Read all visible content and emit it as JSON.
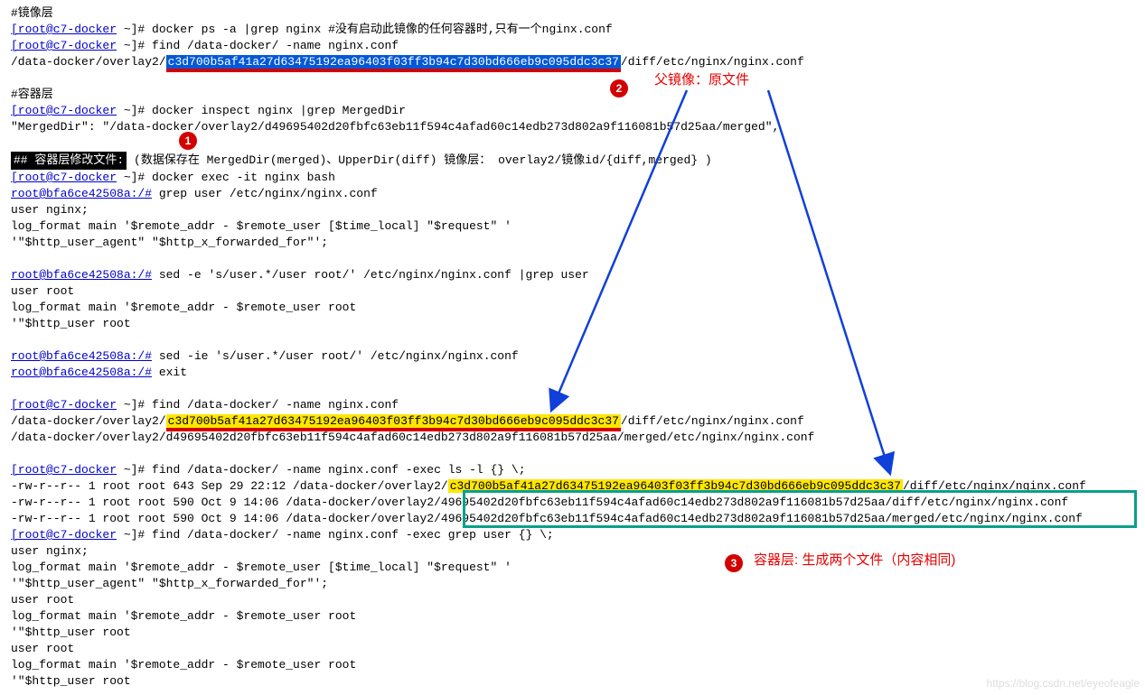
{
  "c1": "#镜像层",
  "c2": "#容器层",
  "host": "[root@c7-docker",
  "tilde": " ~]# ",
  "cont": "root@bfa6ce42508a:/#",
  "l1a": "docker ps -a |grep nginx   #没有启动此镜像的任何容器时,只有一个nginx.conf",
  "l2a": "find /data-docker/ -name nginx.conf",
  "l3_pref": "/data-docker/overlay2/",
  "hash1": "c3d700b5af41a27d63475192ea96403f03ff3b94c7d30bd666eb9c095ddc3c37",
  "l3_suf": "/diff/etc/nginx/nginx.conf",
  "l4a": "docker inspect nginx |grep MergedDir",
  "l5": "            \"MergedDir\": \"/data-docker/overlay2/d49695402d20fbfc63eb11f594c4afad60c14edb273d802a9f116081b57d25aa/merged\",",
  "l6_box": "##  容器层修改文件:",
  "l6_rest": " (数据保存在 MergedDir(merged)、UpperDir(diff) 镜像层：  overlay2/镜像id/{diff,merged} )",
  "l7a": "docker exec -it nginx bash",
  "l8a": " grep user /etc/nginx/nginx.conf",
  "l9": "user  nginx;",
  "l10": "    log_format  main  '$remote_addr - $remote_user [$time_local] \"$request\" '",
  "l11": "                      '\"$http_user_agent\" \"$http_x_forwarded_for\"';",
  "l12a": " sed -e 's/user.*/user root/' /etc/nginx/nginx.conf |grep user",
  "l13": "user root",
  "l14": "    log_format  main  '$remote_addr - $remote_user root",
  "l15": "                      '\"$http_user root",
  "l16a": " sed -ie 's/user.*/user root/' /etc/nginx/nginx.conf",
  "l17a": " exit",
  "l18a": "find /data-docker/ -name nginx.conf",
  "l19_path2": "/data-docker/overlay2/d49695402d20fbfc63eb11f594c4afad60c14edb273d802a9f116081b57d25aa/merged/etc/nginx/nginx.conf",
  "l20a": "find /data-docker/ -name nginx.conf -exec ls -l {} \\;",
  "ls1_pre": "-rw-r--r-- 1 root root 643 Sep 29 22:12 /data-docker/overlay2/",
  "ls2_pre": "-rw-r--r-- 1 root root 590 Oct  9 14:06 /data-docker/overlay2/",
  "hash2p": "49695402d20fbfc63eb11f594c4afad60c14edb273d802a9f116081b57d25aa",
  "ls2_suf": "/diff/etc/nginx/nginx.conf",
  "ls3_pre": "-rw-r--r-- 1 root root 590 Oct  9 14:06 /data-docker/overlay2/",
  "ls3_suf": "/merged/etc/nginx/nginx.conf",
  "l21a": "find /data-docker/ -name nginx.conf -exec grep user {} \\;",
  "anno_parent": "父镜像：原文件",
  "anno_cont": "容器层: 生成两个文件（内容相同)",
  "n1": "1",
  "n2": "2",
  "n3": "3",
  "wm": "https://blog.csdn.net/eyeofeagle"
}
